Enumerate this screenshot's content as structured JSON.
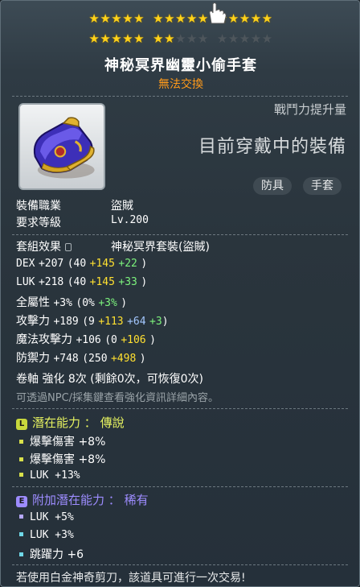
{
  "stars": {
    "row1": [
      5,
      5,
      5
    ],
    "row1_filled": 15,
    "row2_filled": 7,
    "row2_total": 15
  },
  "item": {
    "name": "神秘冥界幽靈小偷手套",
    "trade": "無法交換",
    "icon": "glove-icon"
  },
  "power_label": "戰鬥力提升量",
  "equipped_label": "目前穿戴中的裝備",
  "tags": [
    "防具",
    "手套"
  ],
  "job": {
    "label": "裝備職業",
    "value": "盜賊"
  },
  "level": {
    "label": "要求等級",
    "value": "Lv.200"
  },
  "set": {
    "label": "套組效果",
    "value": "神秘冥界套裝(盜賊)"
  },
  "stats": [
    {
      "name": "DEX",
      "total": "+207",
      "open": "(40",
      "a": "+145",
      "a_color": "y",
      "b": "+22",
      "b_color": "g",
      "close": ")"
    },
    {
      "name": "LUK",
      "total": "+218",
      "open": "(40",
      "a": "+145",
      "a_color": "y",
      "b": "+33",
      "b_color": "g",
      "close": ")"
    },
    {
      "name": "全屬性",
      "total": "+3%",
      "open": "(0%",
      "a": "+3%",
      "a_color": "g",
      "b": "",
      "b_color": "",
      "close": ")"
    },
    {
      "name": "攻擊力",
      "total": "+189",
      "open": "(9",
      "a": "+113",
      "a_color": "y",
      "b": "+64",
      "b_color": "b",
      "c": "+3",
      "c_color": "g",
      "close": ")"
    },
    {
      "name": "魔法攻擊力",
      "total": "+106",
      "open": "(0",
      "a": "+106",
      "a_color": "y",
      "b": "",
      "b_color": "",
      "close": ")"
    },
    {
      "name": "防禦力",
      "total": "+748",
      "open": "(250",
      "a": "+498",
      "a_color": "y",
      "b": "",
      "b_color": "",
      "close": ")"
    }
  ],
  "scroll": {
    "text": "卷軸 強化 8次 (剩餘0次，可恢復0次)"
  },
  "hint": "可透過NPC/採集鍵查看強化資訊詳細內容。",
  "potential": {
    "badge": "L",
    "label": "潛在能力",
    "sep": "：",
    "grade": "傳說",
    "lines": [
      "爆擊傷害 +8%",
      "爆擊傷害 +8%",
      "LUK +13%"
    ]
  },
  "bonus_potential": {
    "badge": "E",
    "label": "附加潛在能力",
    "sep": "：",
    "grade": "稀有",
    "lines": [
      "LUK +5%",
      "LUK +3%",
      "跳躍力 +6"
    ]
  },
  "footer": "若使用白金神奇剪刀，該道具可進行一次交易!",
  "colors": {
    "star": "#ffd21a",
    "orange": "#ff9a1a",
    "yellow": "#ffe030",
    "green": "#7cf27c",
    "blue": "#a4c8ff",
    "legend": "#e6f260",
    "rare": "#9d8cff"
  }
}
